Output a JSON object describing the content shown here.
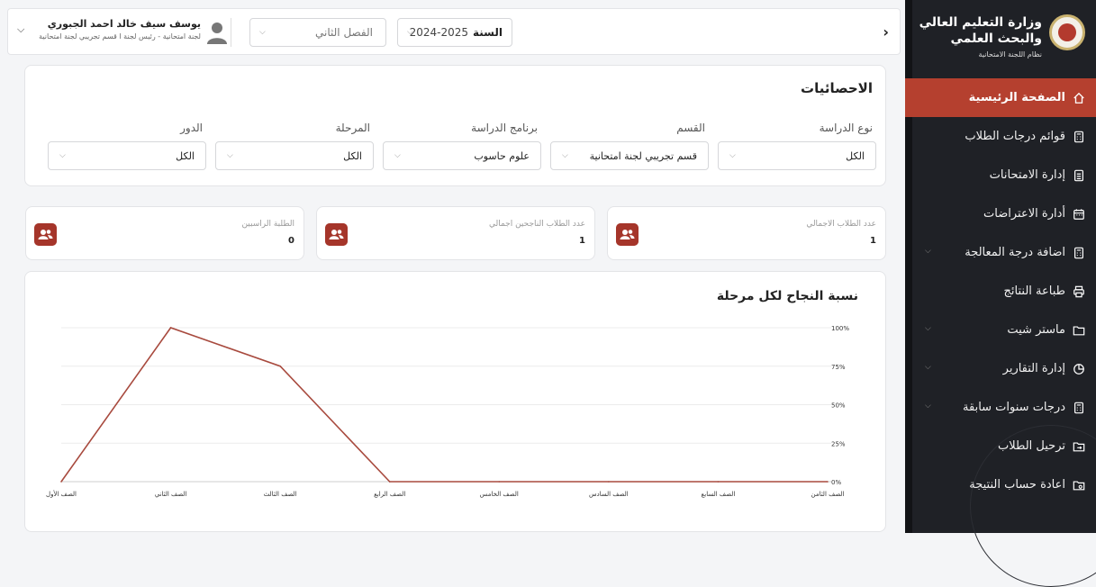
{
  "sidebar": {
    "brand_title": "وزارة التعليم العالي والبحث العلمي",
    "brand_subtitle": "نظام اللجنة الامتحانية",
    "items": [
      {
        "label": "الصفحة الرئيسية",
        "icon": "home-icon",
        "active": true,
        "expandable": false
      },
      {
        "label": "قوائم درجات الطلاب",
        "icon": "calculator-icon",
        "active": false,
        "expandable": false
      },
      {
        "label": "إدارة الامتحانات",
        "icon": "document-icon",
        "active": false,
        "expandable": false
      },
      {
        "label": "أدارة الاعتراضات",
        "icon": "calendar-icon",
        "active": false,
        "expandable": false
      },
      {
        "label": "اضافة درجة المعالجة",
        "icon": "calculator-icon",
        "active": false,
        "expandable": true
      },
      {
        "label": "طباعة النتائج",
        "icon": "printer-icon",
        "active": false,
        "expandable": false
      },
      {
        "label": "ماستر شيت",
        "icon": "folder-icon",
        "active": false,
        "expandable": true
      },
      {
        "label": "إدارة التقارير",
        "icon": "pie-chart-icon",
        "active": false,
        "expandable": true
      },
      {
        "label": "درجات سنوات سابقة",
        "icon": "calculator-icon",
        "active": false,
        "expandable": true
      },
      {
        "label": "ترحيل الطلاب",
        "icon": "folder-transfer-icon",
        "active": false,
        "expandable": false
      },
      {
        "label": "اعادة حساب النتيجة",
        "icon": "folder-refresh-icon",
        "active": false,
        "expandable": false
      }
    ]
  },
  "topbar": {
    "year_label": "السنة",
    "year_value": "2024-2025",
    "semester_value": "الفصل الثاني",
    "user_name": "يوسف سيف خالد احمد الجبوري",
    "user_role": "لجنة امتحانية - رئيس لجنة ا قسم تجريبي لجنة امتحانية"
  },
  "stats": {
    "title": "الاحصائيات",
    "filters": [
      {
        "label": "نوع الدراسة",
        "value": "الكل"
      },
      {
        "label": "القسم",
        "value": "قسم تجريبي لجنة امتحانية"
      },
      {
        "label": "برنامج الدراسة",
        "value": "علوم حاسوب"
      },
      {
        "label": "المرحلة",
        "value": "الكل"
      },
      {
        "label": "الدور",
        "value": "الكل"
      }
    ]
  },
  "kpis": [
    {
      "label": "عدد الطلاب الاجمالي",
      "value": "1"
    },
    {
      "label": "عدد الطلاب الناجحين اجمالي",
      "value": "1"
    },
    {
      "label": "الطلبة الراسبين",
      "value": "0"
    }
  ],
  "colors": {
    "accent": "#b5402f",
    "sidebar_bg": "#1f2126",
    "line": "#a84a3e"
  },
  "chart_data": {
    "type": "line",
    "title": "نسبة النجاح لكل مرحلة",
    "categories": [
      "الصف الأول",
      "الصف الثاني",
      "الصف الثالث",
      "الصف الرابع",
      "الصف الخامس",
      "الصف السادس",
      "الصف السابع",
      "الصف الثامن"
    ],
    "series": [
      {
        "values": [
          0,
          100,
          75,
          0,
          0,
          0,
          0,
          0
        ]
      }
    ],
    "yticks": [
      "0%",
      "25%",
      "50%",
      "75%",
      "100%"
    ],
    "ylim": [
      0,
      100
    ],
    "grid": true
  }
}
